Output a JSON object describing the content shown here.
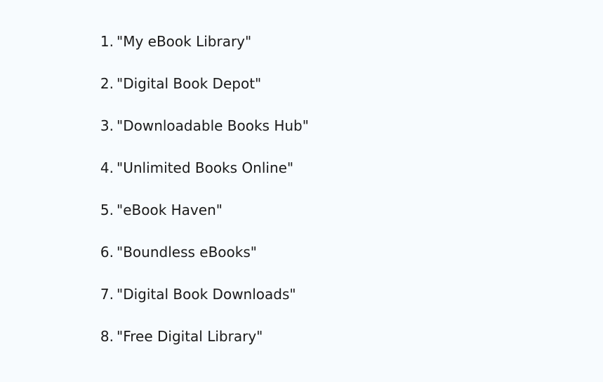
{
  "items": [
    {
      "number": "1.",
      "text": "\"My eBook Library\""
    },
    {
      "number": "2.",
      "text": "\"Digital Book Depot\""
    },
    {
      "number": "3.",
      "text": "\"Downloadable Books Hub\""
    },
    {
      "number": "4.",
      "text": "\"Unlimited Books Online\""
    },
    {
      "number": "5.",
      "text": "\"eBook Haven\""
    },
    {
      "number": "6.",
      "text": "\"Boundless eBooks\""
    },
    {
      "number": "7.",
      "text": "\"Digital Book Downloads\""
    },
    {
      "number": "8.",
      "text": "\"Free Digital Library\""
    }
  ]
}
